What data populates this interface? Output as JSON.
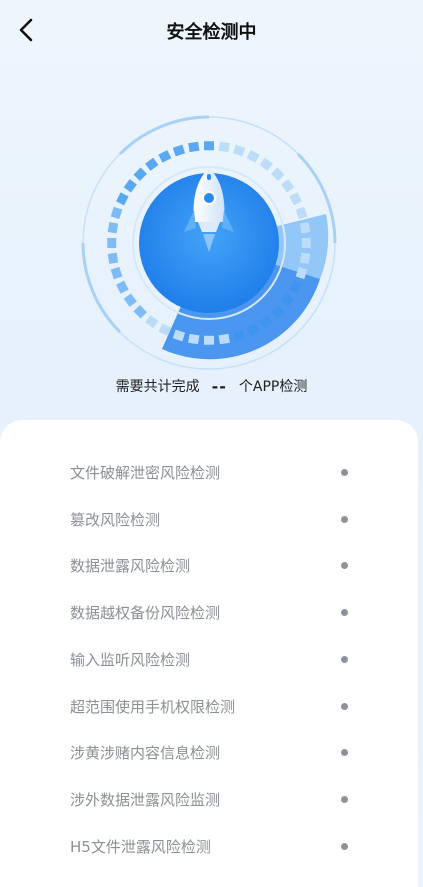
{
  "header": {
    "title": "安全检测中",
    "back_icon": "chevron-left-icon"
  },
  "scanner": {
    "icon": "rocket-icon",
    "accent": "#2b8af0"
  },
  "summary": {
    "prefix": "需要共计完成",
    "count": "--",
    "suffix": "个APP检测"
  },
  "items": [
    {
      "label": "文件破解泄密风险检测"
    },
    {
      "label": "篡改风险检测"
    },
    {
      "label": "数据泄露风险检测"
    },
    {
      "label": "数据越权备份风险检测"
    },
    {
      "label": "输入监听风险检测"
    },
    {
      "label": "超范围使用手机权限检测"
    },
    {
      "label": "涉黄涉赌内容信息检测"
    },
    {
      "label": "涉外数据泄露风险监测"
    },
    {
      "label": "H5文件泄露风险检测"
    }
  ]
}
